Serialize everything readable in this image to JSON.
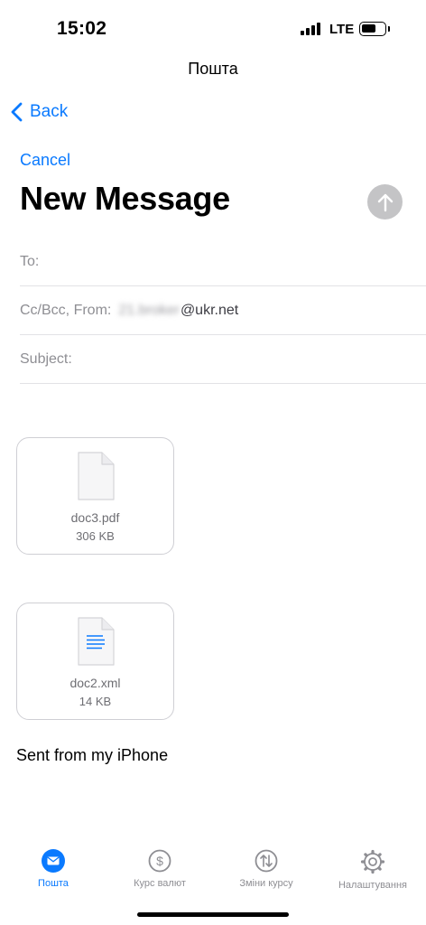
{
  "status_bar": {
    "time": "15:02",
    "network": "LTE",
    "battery_level": 0.65
  },
  "app_title": "Пошта",
  "nav": {
    "back_label": "Back"
  },
  "compose": {
    "cancel_label": "Cancel",
    "title": "New Message",
    "send_icon": "arrow-up-icon",
    "fields": {
      "to_label": "To:",
      "cc_from_label": "Cc/Bcc, From:",
      "from_blurred": "21.broker",
      "from_domain": "@ukr.net",
      "subject_label": "Subject:"
    },
    "attachments": [
      {
        "name": "doc3.pdf",
        "size": "306 KB",
        "icon": "pdf-file-icon"
      },
      {
        "name": "doc2.xml",
        "size": "14 KB",
        "icon": "text-file-icon"
      }
    ],
    "signature": "Sent from my iPhone"
  },
  "tabs": [
    {
      "label": "Пошта",
      "icon": "mail-icon",
      "active": true
    },
    {
      "label": "Курс валют",
      "icon": "dollar-icon",
      "active": false
    },
    {
      "label": "Зміни курсу",
      "icon": "exchange-icon",
      "active": false
    },
    {
      "label": "Налаштування",
      "icon": "gear-icon",
      "active": false
    }
  ],
  "colors": {
    "accent": "#0a7aff",
    "inactive": "#8e8e93",
    "send_disabled": "#c4c4c6"
  }
}
